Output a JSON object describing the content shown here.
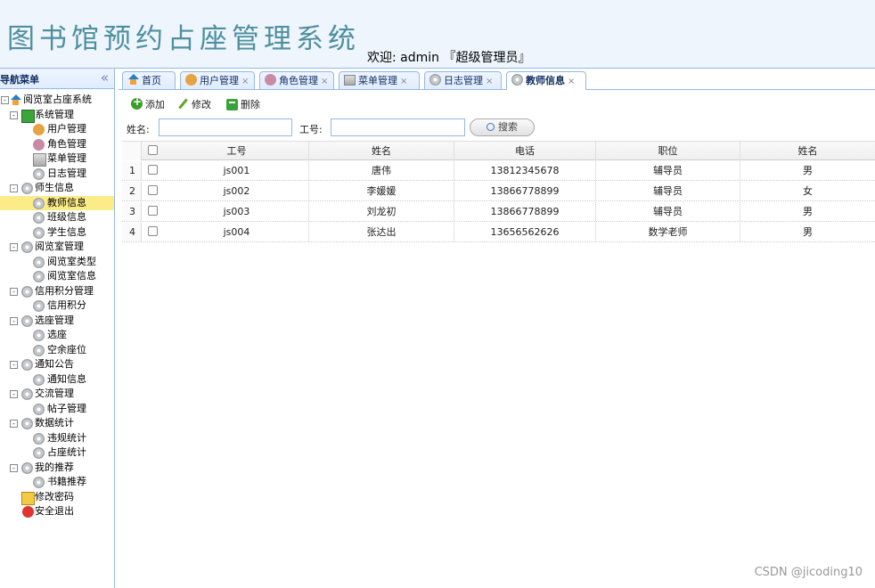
{
  "header": {
    "app_title": "图书馆预约占座管理系统",
    "welcome": "欢迎: admin 『超级管理员』"
  },
  "sidebar": {
    "title": "导航菜单",
    "collapse_icon": "«",
    "tree": {
      "root": "阅览室占座系统",
      "system": "系统管理",
      "user_mgmt": "用户管理",
      "role_mgmt": "角色管理",
      "menu_mgmt": "菜单管理",
      "log_mgmt": "日志管理",
      "teacher_student": "师生信息",
      "teacher_info": "教师信息",
      "class_info": "班级信息",
      "student_info": "学生信息",
      "reading_room_mgmt": "阅览室管理",
      "reading_room_type": "阅览室类型",
      "reading_room_info": "阅览室信息",
      "credit_mgmt": "信用积分管理",
      "credit": "信用积分",
      "seat_mgmt": "选座管理",
      "seat_select": "选座",
      "vacant_seat": "空余座位",
      "notice": "通知公告",
      "notice_info": "通知信息",
      "forum_mgmt": "交流管理",
      "post_mgmt": "帖子管理",
      "statistics": "数据统计",
      "violation_stats": "违规统计",
      "occupancy_stats": "占座统计",
      "recommend": "我的推荐",
      "book_recommend": "书籍推荐",
      "change_password": "修改密码",
      "logout": "安全退出"
    }
  },
  "tabs": [
    {
      "label": "首页",
      "icon": "home-icon",
      "closable": false
    },
    {
      "label": "用户管理",
      "icon": "user-icon",
      "closable": true
    },
    {
      "label": "角色管理",
      "icon": "role-icon",
      "closable": true
    },
    {
      "label": "菜单管理",
      "icon": "menu-icon",
      "closable": true
    },
    {
      "label": "日志管理",
      "icon": "gear-icon",
      "closable": true
    },
    {
      "label": "教师信息",
      "icon": "gear-icon",
      "closable": true,
      "active": true
    }
  ],
  "tab_close": "×",
  "toolbar": {
    "add": "添加",
    "edit": "修改",
    "delete": "删除"
  },
  "search": {
    "name_label": "姓名:",
    "name_value": "",
    "id_label": "工号:",
    "id_value": "",
    "button": "搜索"
  },
  "grid": {
    "columns": [
      "工号",
      "姓名",
      "电话",
      "职位",
      "姓名"
    ],
    "rows": [
      {
        "num": "1",
        "id": "js001",
        "name": "唐伟",
        "phone": "13812345678",
        "position": "辅导员",
        "gender": "男"
      },
      {
        "num": "2",
        "id": "js002",
        "name": "李媛媛",
        "phone": "13866778899",
        "position": "辅导员",
        "gender": "女"
      },
      {
        "num": "3",
        "id": "js003",
        "name": "刘龙初",
        "phone": "13866778899",
        "position": "辅导员",
        "gender": "男"
      },
      {
        "num": "4",
        "id": "js004",
        "name": "张达出",
        "phone": "13656562626",
        "position": "数学老师",
        "gender": "男"
      }
    ]
  },
  "watermark": "CSDN @jicoding10",
  "colors": {
    "border": "#95b8e7",
    "header_bg": "#eef5fc",
    "title": "#4f8fa0",
    "selected": "#fbec88"
  }
}
